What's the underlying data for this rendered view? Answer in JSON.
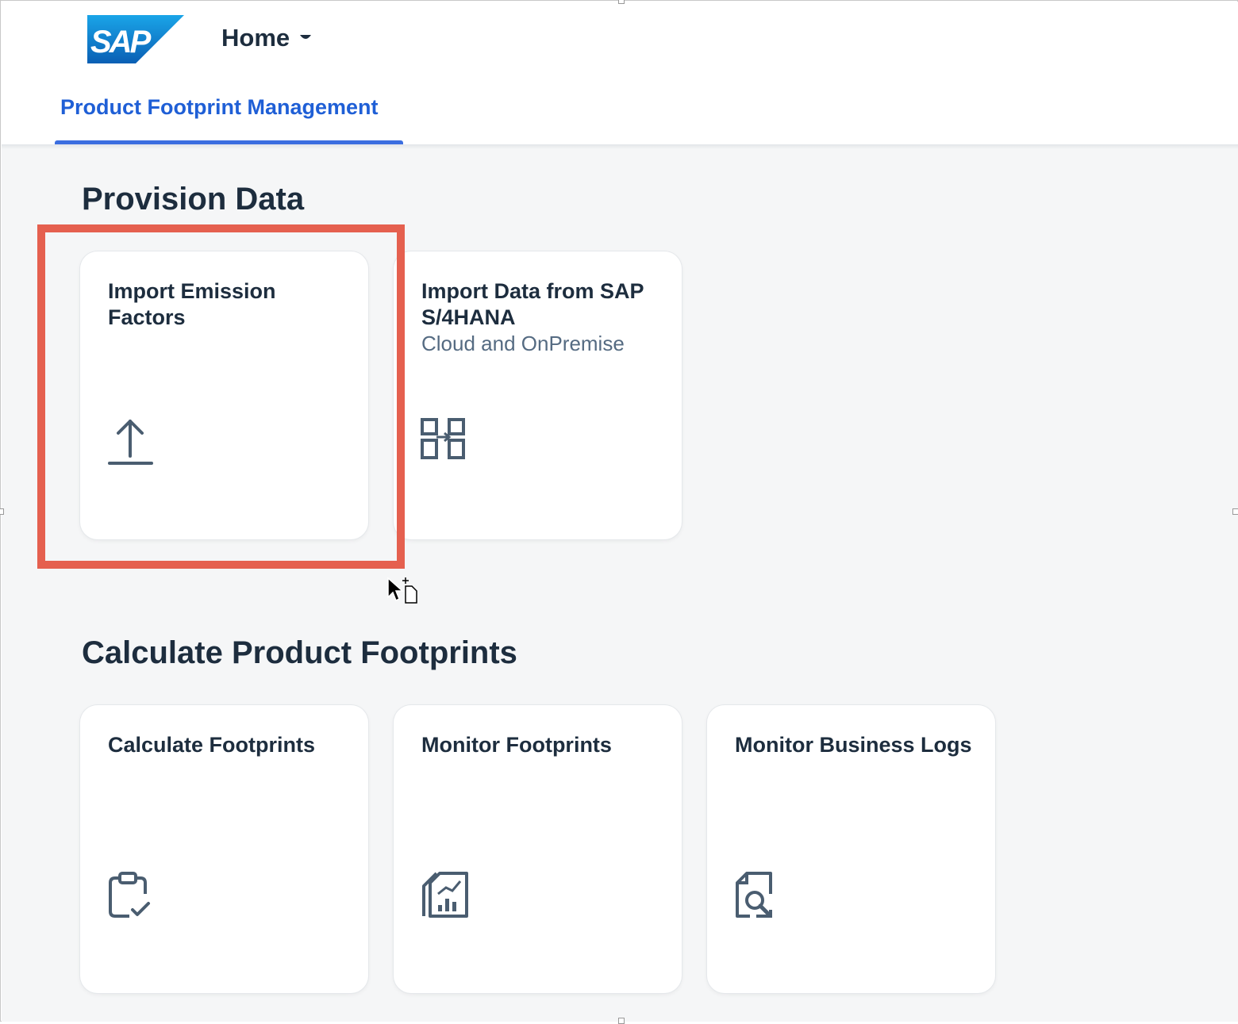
{
  "shell": {
    "logo_text": "SAP",
    "home_label": "Home",
    "tab_label": "Product Footprint Management"
  },
  "sections": [
    {
      "title": "Provision Data",
      "tiles": [
        {
          "title": "Import Emission Factors",
          "subtitle": "",
          "icon": "upload-icon"
        },
        {
          "title": "Import Data from SAP S/4HANA",
          "subtitle": "Cloud and OnPremise",
          "icon": "data-exchange-icon"
        }
      ]
    },
    {
      "title": "Calculate Product Footprints",
      "tiles": [
        {
          "title": "Calculate Footprints",
          "subtitle": "",
          "icon": "clipboard-check-icon"
        },
        {
          "title": "Monitor Footprints",
          "subtitle": "",
          "icon": "report-chart-icon"
        },
        {
          "title": "Monitor Business Logs",
          "subtitle": "",
          "icon": "document-search-icon"
        }
      ]
    }
  ],
  "colors": {
    "accent": "#3b6ee0",
    "highlight": "#e5604f",
    "text": "#1d2d3e",
    "icon": "#4a5d70",
    "background": "#f5f6f7"
  }
}
